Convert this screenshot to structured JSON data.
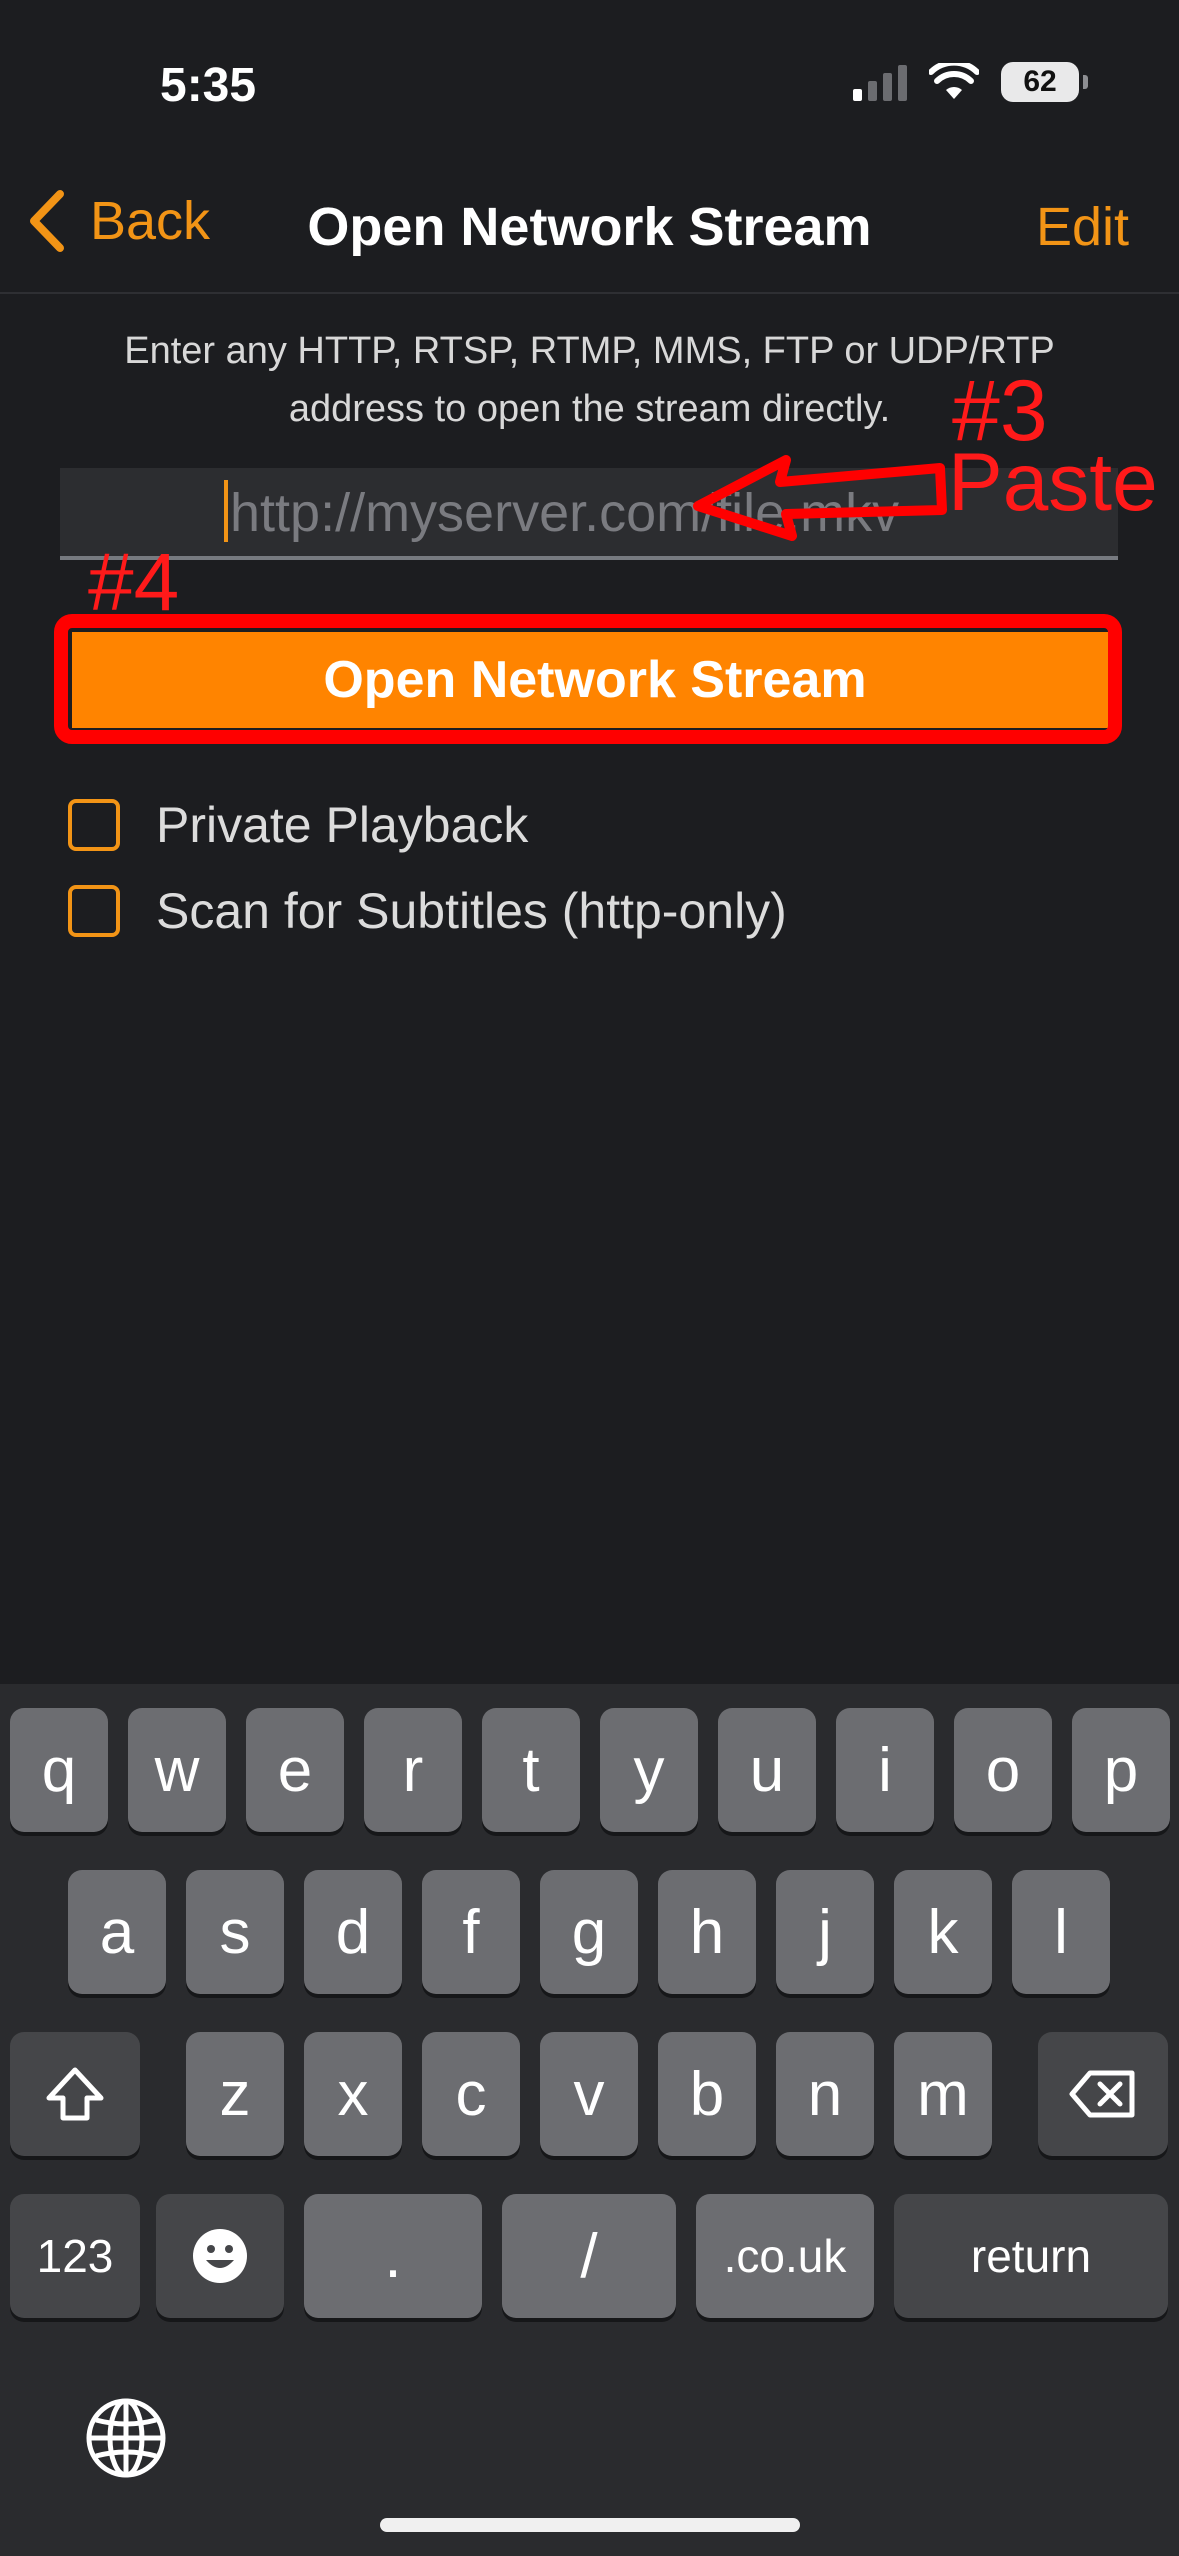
{
  "status": {
    "time": "5:35",
    "battery": "62"
  },
  "nav": {
    "back_label": "Back",
    "title": "Open Network Stream",
    "edit_label": "Edit"
  },
  "content": {
    "instructions": "Enter any HTTP, RTSP, RTMP, MMS, FTP or UDP/RTP address to open the stream directly.",
    "url_placeholder": "http://myserver.com/file.mkv",
    "url_value": "",
    "open_button": "Open Network Stream",
    "options": [
      {
        "label": "Private Playback",
        "checked": false
      },
      {
        "label": "Scan for Subtitles (http-only)",
        "checked": false
      }
    ]
  },
  "annotations": {
    "step3": "#3",
    "paste": "Paste",
    "step4": "#4",
    "color": "#ff0000"
  },
  "accent_color": "#f29416",
  "keyboard": {
    "row1": [
      "q",
      "w",
      "e",
      "r",
      "t",
      "y",
      "u",
      "i",
      "o",
      "p"
    ],
    "row2": [
      "a",
      "s",
      "d",
      "f",
      "g",
      "h",
      "j",
      "k",
      "l"
    ],
    "row3": [
      "z",
      "x",
      "c",
      "v",
      "b",
      "n",
      "m"
    ],
    "row4": {
      "numbers": "123",
      "dot": ".",
      "slash": "/",
      "domain": ".co.uk",
      "return": "return"
    }
  }
}
